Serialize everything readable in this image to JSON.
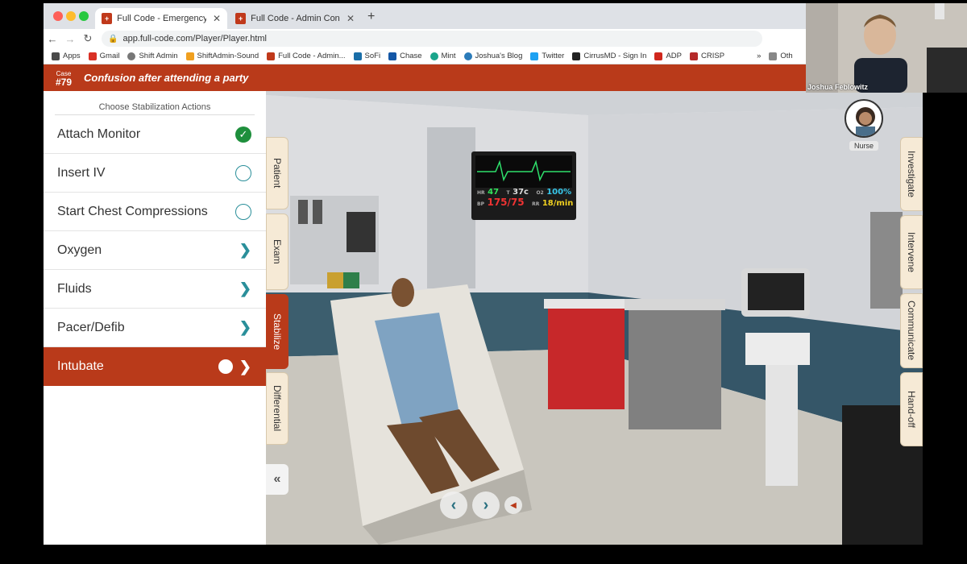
{
  "browser": {
    "tabs": [
      {
        "title": "Full Code - Emergency Medicine",
        "active": true
      },
      {
        "title": "Full Code - Admin Console",
        "active": false
      }
    ],
    "url": "app.full-code.com/Player/Player.html",
    "bookmarks": [
      "Apps",
      "Gmail",
      "Shift Admin",
      "ShiftAdmin-Sound",
      "Full Code - Admin...",
      "SoFi",
      "Chase",
      "Mint",
      "Joshua's Blog",
      "Twitter",
      "CirrusMD - Sign In",
      "ADP",
      "CRISP"
    ],
    "bookmarks_overflow": "»",
    "other_bookmarks": "Oth"
  },
  "case": {
    "label": "Case",
    "id": "#79",
    "title": "Confusion after attending a party"
  },
  "stabilize_panel": {
    "heading": "Choose Stabilization Actions",
    "actions": [
      {
        "label": "Attach Monitor",
        "state": "done"
      },
      {
        "label": "Insert IV",
        "state": "available"
      },
      {
        "label": "Start Chest Compressions",
        "state": "available"
      },
      {
        "label": "Oxygen",
        "state": "submenu"
      },
      {
        "label": "Fluids",
        "state": "submenu"
      },
      {
        "label": "Pacer/Defib",
        "state": "submenu"
      },
      {
        "label": "Intubate",
        "state": "selected"
      }
    ]
  },
  "left_tabs": [
    "Patient",
    "Exam",
    "Stabilize",
    "Differential"
  ],
  "right_tabs": [
    "Investigate",
    "Intervene",
    "Communicate",
    "Hand-off"
  ],
  "monitor": {
    "hr_label": "HR",
    "hr": "47",
    "t_label": "T",
    "t": "37c",
    "o2_label": "O2",
    "o2": "100%",
    "bp_label": "BP",
    "bp": "175/75",
    "rr_label": "RR",
    "rr": "18/min"
  },
  "nurse": {
    "label": "Nurse"
  },
  "webcam": {
    "name": "Joshua Feblowitz"
  },
  "colors": {
    "brand_red": "#b93a1a",
    "teal": "#2a8f9a",
    "check_green": "#1e8f3c"
  }
}
